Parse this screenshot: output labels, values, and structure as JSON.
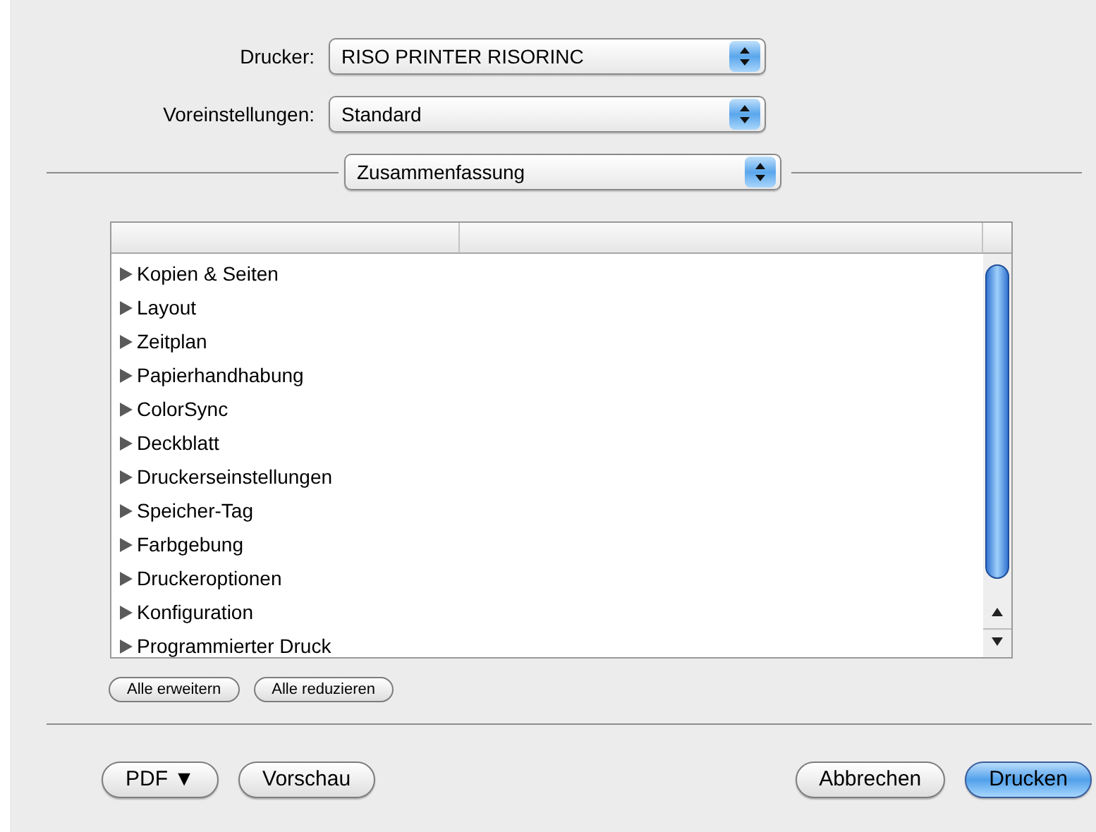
{
  "popups": [
    {
      "label": "Drucker:",
      "value": "RISO PRINTER RISORINC"
    },
    {
      "label": "Voreinstellungen:",
      "value": "Standard"
    }
  ],
  "panel_popup": {
    "value": "Zusammenfassung"
  },
  "outline": {
    "items": [
      {
        "name": "Kopien & Seiten",
        "expanded": false
      },
      {
        "name": "Layout",
        "expanded": false
      },
      {
        "name": "Zeitplan",
        "expanded": false
      },
      {
        "name": "Papierhandhabung",
        "expanded": false
      },
      {
        "name": "ColorSync",
        "expanded": false
      },
      {
        "name": "Deckblatt",
        "expanded": false
      },
      {
        "name": "Druckerseinstellungen",
        "expanded": false
      },
      {
        "name": "Speicher-Tag",
        "expanded": false
      },
      {
        "name": "Farbgebung",
        "expanded": false
      },
      {
        "name": "Druckeroptionen",
        "expanded": false
      },
      {
        "name": "Konfiguration",
        "expanded": false
      },
      {
        "name": "Programmierter Druck",
        "expanded": false
      }
    ]
  },
  "outline_buttons": [
    "Alle erweitern",
    "Alle reduzieren"
  ],
  "left_buttons": [
    {
      "label": "PDF ▼",
      "default": false
    },
    {
      "label": "Vorschau",
      "default": false
    }
  ],
  "right_buttons": [
    {
      "label": "Abbrechen",
      "default": false
    },
    {
      "label": "Drucken",
      "default": true
    }
  ]
}
